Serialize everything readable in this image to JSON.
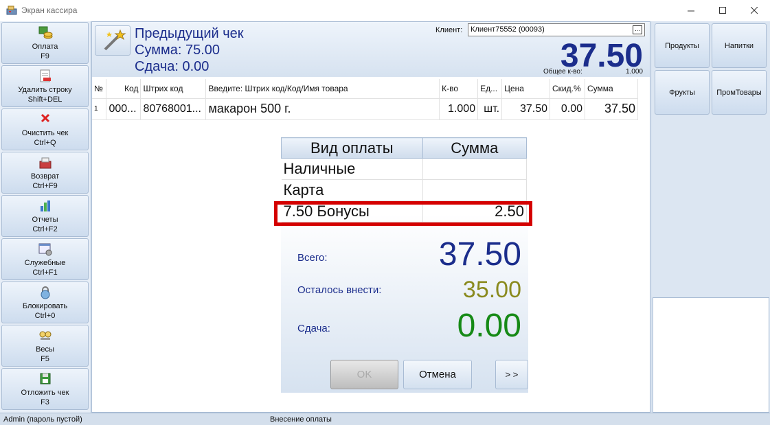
{
  "window": {
    "title": "Экран кассира"
  },
  "sidebar": {
    "items": [
      {
        "icon": "coins-icon",
        "label": "Оплата",
        "shortcut": "F9"
      },
      {
        "icon": "delete-row-icon",
        "label": "Удалить строку",
        "shortcut": "Shift+DEL"
      },
      {
        "icon": "clear-icon",
        "label": "Очистить чек",
        "shortcut": "Ctrl+Q"
      },
      {
        "icon": "return-icon",
        "label": "Возврат",
        "shortcut": "Ctrl+F9"
      },
      {
        "icon": "reports-icon",
        "label": "Отчеты",
        "shortcut": "Ctrl+F2"
      },
      {
        "icon": "service-icon",
        "label": "Служебные",
        "shortcut": "Ctrl+F1"
      },
      {
        "icon": "lock-icon",
        "label": "Блокировать",
        "shortcut": "Ctrl+0"
      },
      {
        "icon": "scales-icon",
        "label": "Весы",
        "shortcut": "F5"
      },
      {
        "icon": "save-icon",
        "label": "Отложить чек",
        "shortcut": "F3"
      }
    ]
  },
  "header": {
    "prev_title": "Предыдущий чек",
    "prev_sum": "Сумма: 75.00",
    "prev_change": "Сдача: 0.00",
    "client_label": "Клиент:",
    "client_value": "Клиент75552 (00093)",
    "client_button": "...",
    "total": "37.50",
    "qty_label": "Общее к-во:",
    "qty_value": "1.000"
  },
  "items_table": {
    "columns": [
      "№",
      "Код",
      "Штрих код",
      "Введите: Штрих код/Код/Имя товара",
      "К-во",
      "Ед...",
      "Цена",
      "Скид.%",
      "Сумма"
    ],
    "rows": [
      [
        "1",
        "000...",
        "80768001...",
        "макарон 500 г.",
        "1.000",
        "шт.",
        "37.50",
        "0.00",
        "37.50"
      ]
    ]
  },
  "categories": [
    "Продукты",
    "Напитки",
    "Фрукты",
    "ПромТовары"
  ],
  "payment": {
    "col_type": "Вид оплаты",
    "col_sum": "Сумма",
    "rows": [
      {
        "type": "Наличные",
        "sum": ""
      },
      {
        "type": "Карта",
        "sum": ""
      },
      {
        "type": "7.50 Бонусы",
        "sum": "2.50"
      }
    ],
    "total_label": "Всего:",
    "total_value": "37.50",
    "remaining_label": "Осталось внести:",
    "remaining_value": "35.00",
    "change_label": "Сдача:",
    "change_value": "0.00",
    "ok_label": "OK",
    "cancel_label": "Отмена",
    "next_label": "> >"
  },
  "status": {
    "user": "Admin (пароль пустой)",
    "message": "Внесение оплаты"
  },
  "colors": {
    "accent_blue": "#1b2d8c",
    "remaining_olive": "#8a8a1e",
    "change_green": "#168a16",
    "highlight_red": "#d40000"
  }
}
